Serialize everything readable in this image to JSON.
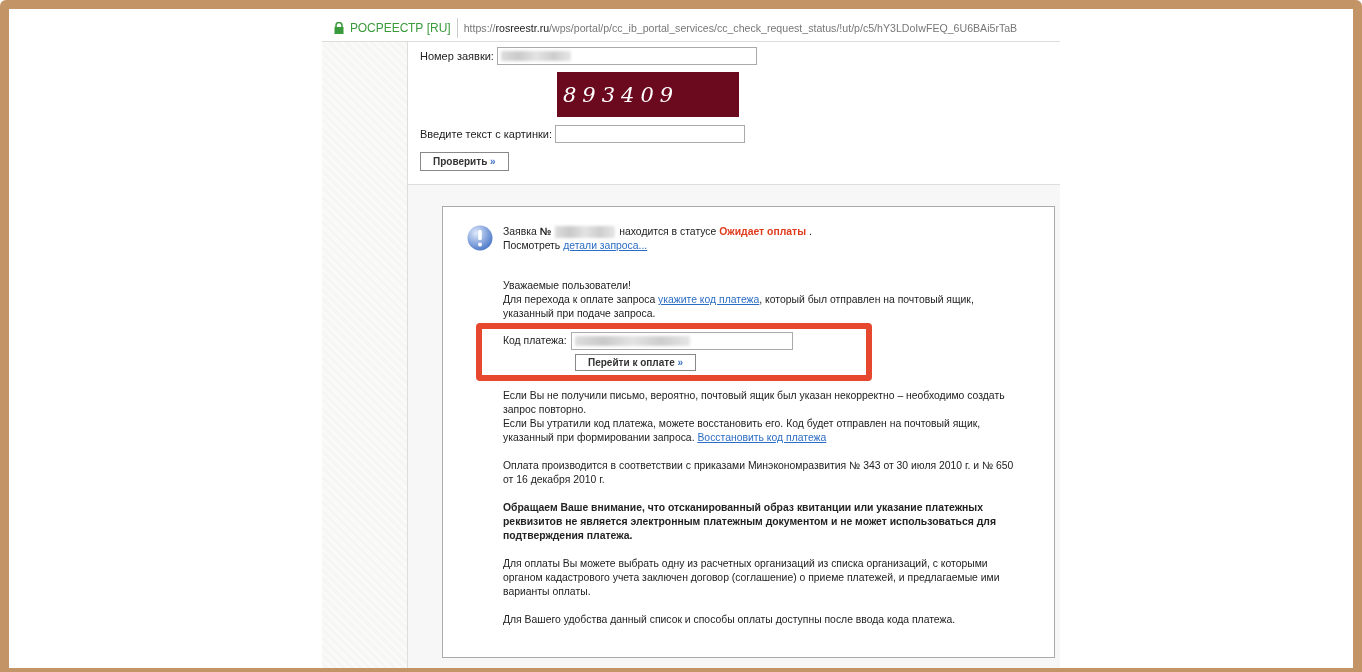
{
  "address_bar": {
    "site_name": "РОСРЕЕСТР [RU]",
    "url_prefix": "https://",
    "url_domain": "rosreestr.ru",
    "url_path": "/wps/portal/p/cc_ib_portal_services/cc_check_request_status/!ut/p/c5/hY3LDoIwFEQ_6U6BAi5rTaB"
  },
  "request_form": {
    "number_label": "Номер заявки:",
    "captcha": "893409",
    "captcha_label": "Введите текст с картинки:",
    "check_button": "Проверить",
    "button_arrow": "»"
  },
  "status_panel": {
    "status_prefix": "Заявка",
    "number_sign": "№",
    "status_middle": "находится в статусе",
    "status": "Ожидает оплаты",
    "status_end": ".",
    "details_prefix": "Посмотреть",
    "details_link": "детали запроса...",
    "greeting": "Уважаемые пользователи!",
    "instruction_prefix": "Для перехода к оплате запроса",
    "instruction_link": "укажите код платежа",
    "instruction_suffix": ", который был отправлен на почтовый ящик, указанный при подаче запроса.",
    "code_label": "Код платежа:",
    "pay_button": "Перейти к оплате",
    "pay_arrow": "»",
    "no_letter_note": "Если Вы не получили письмо, вероятно, почтовый ящик был указан некорректно – необходимо создать запрос повторно.",
    "lost_code_note": "Если Вы утратили код платежа, можете восстановить его. Код будет отправлен на почтовый ящик, указанный при формировании запроса.",
    "restore_link": "Восстановить код платежа",
    "legal_note": "Оплата производится в соответствии с приказами Минэкономразвития № 343 от 30 июля 2010 г. и № 650 от 16 декабря 2010 г.",
    "warning": "Обращаем Ваше внимание, что отсканированный образ квитанции или указание платежных реквизитов не является электронным платежным документом и не может использоваться для подтверждения платежа.",
    "organizations_note": "Для оплаты Вы можете выбрать одну из расчетных организаций из списка организаций, с которыми органом кадастрового учета заключен договор (соглашение) о приеме платежей, и предлагаемые ими варианты оплаты.",
    "availability_note": "Для Вашего удобства данный список и способы оплаты доступны после ввода кода платежа."
  }
}
